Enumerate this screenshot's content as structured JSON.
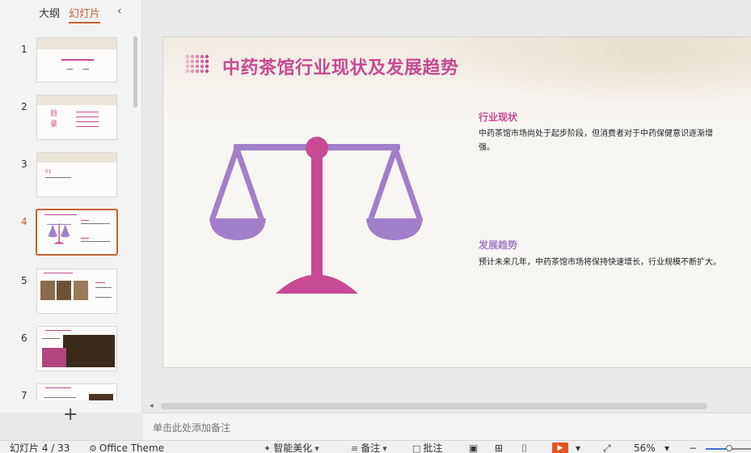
{
  "panel_tabs": {
    "outline": "大纲",
    "slides": "幻灯片",
    "collapse_icon": "chevron-left-icon"
  },
  "thumbnails": [
    {
      "number": "1"
    },
    {
      "number": "2",
      "label_line1": "目",
      "label_line2": "录"
    },
    {
      "number": "3",
      "label": "01"
    },
    {
      "number": "4"
    },
    {
      "number": "5"
    },
    {
      "number": "6"
    },
    {
      "number": "7"
    }
  ],
  "add_slide_label": "+",
  "slide": {
    "title": "中药茶馆行业现状及发展趋势",
    "blocks": [
      {
        "heading": "行业现状",
        "body": "中药茶馆市场尚处于起步阶段，但消费者对于中药保健意识逐渐增强。"
      },
      {
        "heading": "发展趋势",
        "body": "预计未来几年，中药茶馆市场将保持快速增长，行业规模不断扩大。"
      }
    ],
    "scale_icon": "balance-scale-icon",
    "colors": {
      "pink": "#c84a92",
      "purple": "#a27fc9",
      "purple_light": "#b48ad6"
    }
  },
  "notes": {
    "placeholder": "单击此处添加备注"
  },
  "status": {
    "slide_counter": "幻灯片 4 / 33",
    "theme": "Office Theme",
    "beautify": "智能美化",
    "notes_btn": "备注",
    "comments_btn": "批注",
    "zoom": "56%",
    "zoom_fraction": 0.56
  }
}
